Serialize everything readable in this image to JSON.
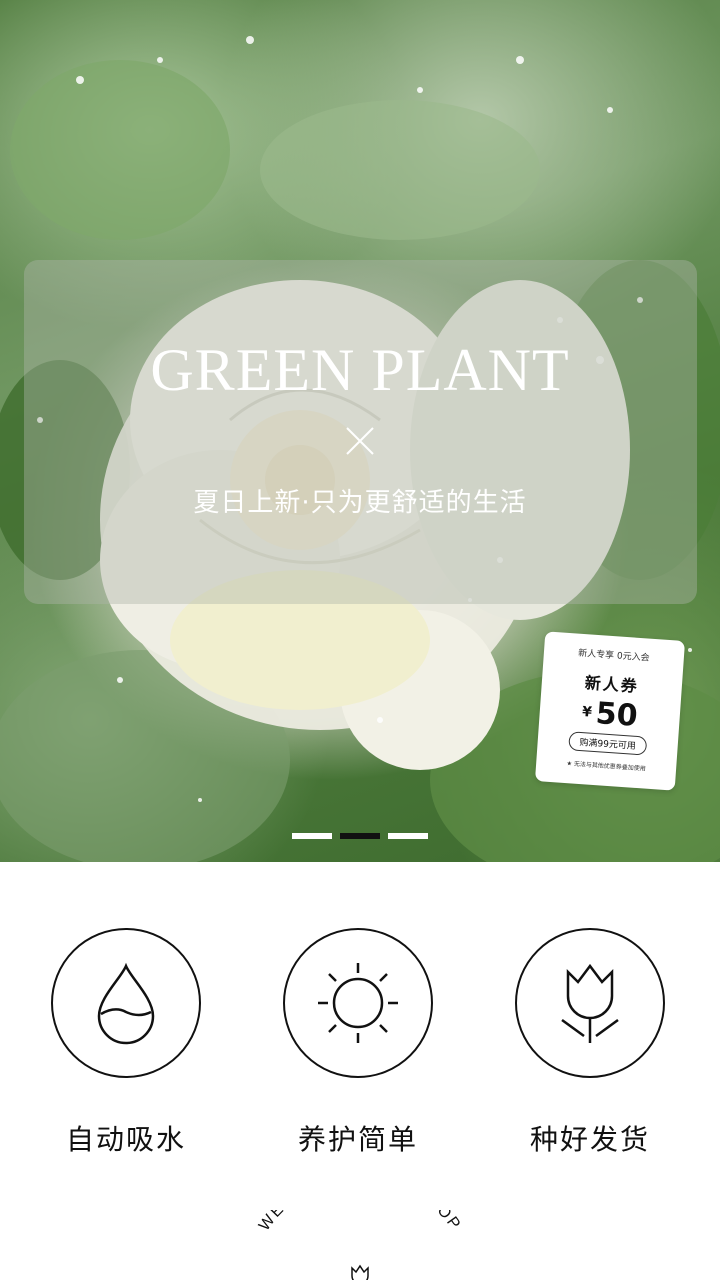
{
  "hero": {
    "title": "GREEN PLANT",
    "subtitle": "夏日上新·只为更舒适的生活",
    "carousel": {
      "count": 3,
      "active_index": 1
    }
  },
  "coupon": {
    "top_line": "新人专享 0元入会",
    "title": "新人券",
    "currency": "¥",
    "amount": "50",
    "condition": "购满99元可用",
    "note": "★ 无法与其他优惠券叠加使用"
  },
  "features": [
    {
      "label": "自动吸水",
      "icon": "water-drop-icon"
    },
    {
      "label": "养护简单",
      "icon": "sun-icon"
    },
    {
      "label": "种好发货",
      "icon": "tulip-icon"
    }
  ],
  "welcome": {
    "text": "WELCOME TO MY SHOP"
  },
  "colors": {
    "accent": "#111111",
    "background": "#ffffff"
  }
}
